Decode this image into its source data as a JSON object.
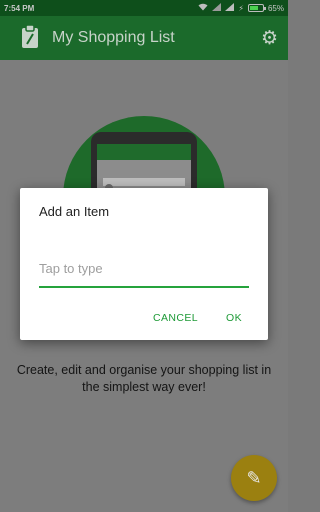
{
  "status_bar": {
    "time": "7:54 PM",
    "wifi_icon": "wifi-icon",
    "signal_icons": [
      "signal-icon",
      "signal-icon"
    ],
    "charging_icon": "charging-icon",
    "battery_percent": "65%",
    "battery_level": 0.65
  },
  "app_bar": {
    "title": "My Shopping List",
    "logo_icon": "clipboard-icon",
    "settings_icon": "gear-icon"
  },
  "content": {
    "tagline": "Create, edit and organise your shopping list in the simplest way ever!"
  },
  "dialog": {
    "title": "Add an Item",
    "input_value": "",
    "input_placeholder": "Tap to type",
    "cancel_label": "CANCEL",
    "ok_label": "OK"
  },
  "fab": {
    "icon": "pencil-icon"
  },
  "colors": {
    "primary_dark": "#0e4f1b",
    "primary": "#1b6a2b",
    "accent_green": "#25a33c",
    "fab_yellow": "#9b8010",
    "scrim_gray": "#7d7d7d"
  }
}
